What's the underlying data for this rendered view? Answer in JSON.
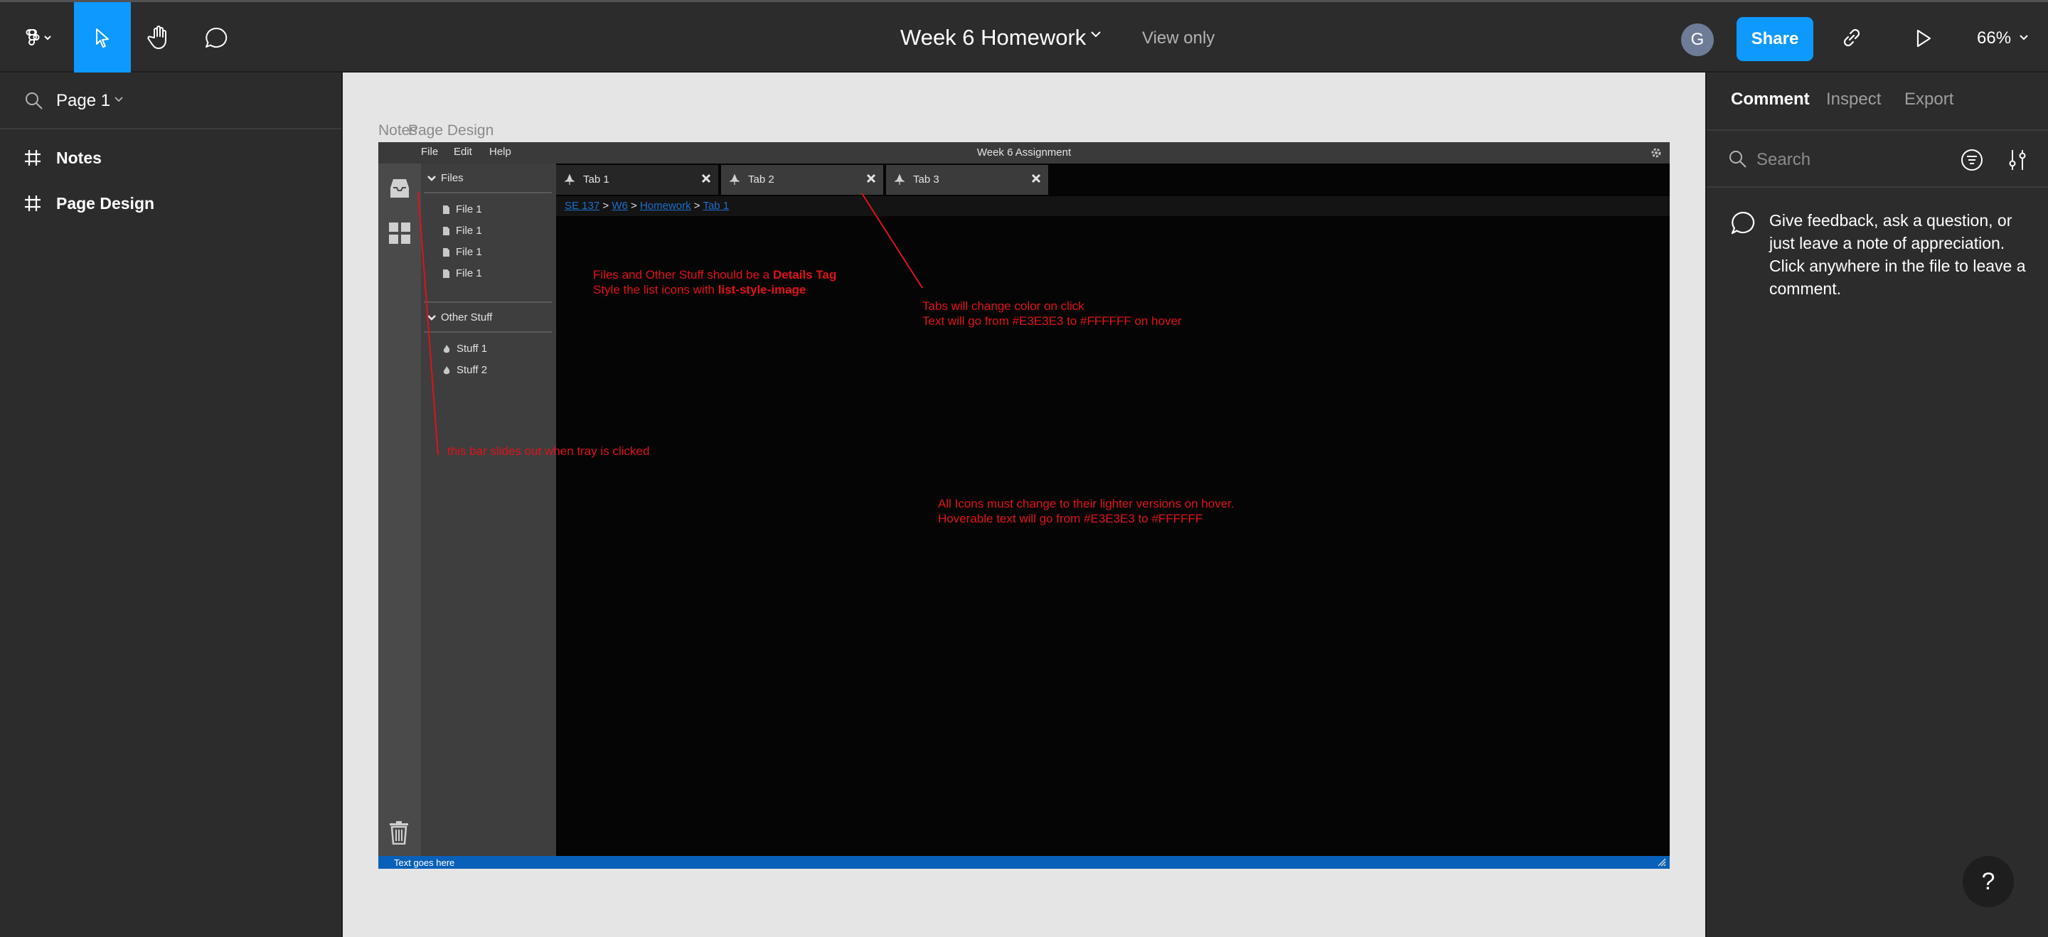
{
  "toolbar": {
    "file_title": "Week 6 Homework",
    "view_only": "View only",
    "avatar_initial": "G",
    "share_label": "Share",
    "zoom": "66%",
    "accent": "#0d99ff"
  },
  "left_panel": {
    "page_label": "Page 1",
    "frames": [
      "Notes",
      "Page Design"
    ]
  },
  "canvas": {
    "frame_labels": [
      "Notes",
      "Page Design"
    ],
    "mock": {
      "menu": [
        "File",
        "Edit",
        "Help"
      ],
      "window_title": "Week 6 Assignment",
      "sections": {
        "files": {
          "title": "Files",
          "items": [
            "File 1",
            "File 1",
            "File 1",
            "File 1"
          ]
        },
        "other": {
          "title": "Other Stuff",
          "items": [
            "Stuff 1",
            "Stuff 2"
          ]
        }
      },
      "tabs": [
        "Tab 1",
        "Tab 2",
        "Tab 3"
      ],
      "breadcrumb": [
        "SE 137",
        "W6",
        "Homework",
        "Tab 1"
      ],
      "breadcrumb_sep": ">",
      "status_text": "Text goes here",
      "status_color": "#0860b8"
    },
    "notes": {
      "details_line1_prefix": "Files and Other Stuff should be a ",
      "details_line1_bold": "Details Tag",
      "details_line2_prefix": "Style the list icons with ",
      "details_line2_bold": "list-style-image",
      "tabs_line1": "Tabs will change color on click",
      "tabs_line2": "Text will go from  #E3E3E3 to #FFFFFF on hover",
      "bar_note": "this bar slides out when tray is clicked",
      "icons_line1": "All Icons must  change to their lighter versions on hover.",
      "icons_line2": "Hoverable text will go from  #E3E3E3 to #FFFFFF",
      "note_color": "#e0121b"
    }
  },
  "right_panel": {
    "tabs": [
      "Comment",
      "Inspect",
      "Export"
    ],
    "search_placeholder": "Search",
    "help_text": "Give feedback, ask a question, or just leave a note of appreciation. Click anywhere in the file to leave a comment.",
    "help_button": "?"
  }
}
